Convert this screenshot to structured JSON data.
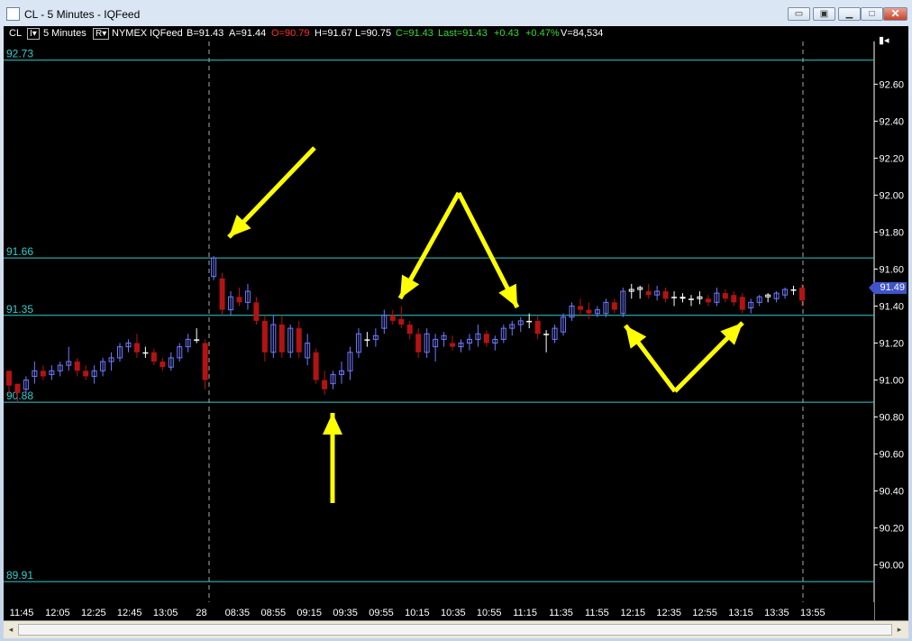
{
  "window": {
    "title": "CL - 5 Minutes - IQFeed",
    "buttons": [
      "restore-down",
      "restore",
      "minimize",
      "maximize",
      "close"
    ]
  },
  "infobar": {
    "symbol": "CL",
    "interval_box": "I▾",
    "interval": "5 Minutes",
    "range_box": "R▾",
    "exchange": "NYMEX",
    "feed": "IQFeed",
    "bid": "B=91.43",
    "ask": "A=91.44",
    "open": "O=90.79",
    "high": "H=91.67",
    "low": "L=90.75",
    "close": "C=91.43",
    "last": "Last=91.43",
    "change": "+0.43",
    "change_pct": "+0.47%",
    "volume": "V=84,534"
  },
  "colors": {
    "up_candle": "#6f79ff",
    "down_candle": "#b31313",
    "doji": "#ffffff",
    "level_line": "#33cccc",
    "axis_text": "#ffffff",
    "arrow": "#ffff00",
    "open_red": "#ff3030",
    "green": "#33dd33"
  },
  "chart": {
    "axis_button": "▮◂",
    "current_price": "91.49",
    "y_ticks": [
      "92.60",
      "92.40",
      "92.20",
      "92.00",
      "91.80",
      "91.60",
      "91.40",
      "91.20",
      "91.00",
      "90.80",
      "90.60",
      "90.40",
      "90.20",
      "90.00"
    ],
    "levels": [
      {
        "label": "92.73",
        "price": 92.73
      },
      {
        "label": "91.66",
        "price": 91.66
      },
      {
        "label": "91.35",
        "price": 91.35
      },
      {
        "label": "90.88",
        "price": 90.88
      },
      {
        "label": "89.91",
        "price": 89.91
      }
    ],
    "x_ticks": [
      "11:45",
      "12:05",
      "12:25",
      "12:45",
      "13:05",
      "28",
      "08:35",
      "08:55",
      "09:15",
      "09:35",
      "09:55",
      "10:15",
      "10:35",
      "10:55",
      "11:15",
      "11:35",
      "11:55",
      "12:15",
      "12:35",
      "12:55",
      "13:15",
      "13:35",
      "13:55"
    ],
    "annotations": "yellow arrows"
  },
  "chart_data": {
    "type": "candlestick",
    "title": "CL - 5 Minutes - IQFeed",
    "xlabel": "",
    "ylabel": "",
    "ylim": [
      89.9,
      92.75
    ],
    "candles": [
      [
        91.05,
        91.0,
        90.92,
        90.97
      ],
      [
        90.98,
        90.98,
        90.88,
        90.93
      ],
      [
        90.95,
        91.02,
        90.92,
        91.0
      ],
      [
        91.02,
        91.1,
        90.98,
        91.05
      ],
      [
        91.05,
        91.08,
        91.0,
        91.02
      ],
      [
        91.03,
        91.08,
        91.0,
        91.05
      ],
      [
        91.05,
        91.1,
        91.02,
        91.08
      ],
      [
        91.08,
        91.18,
        91.05,
        91.1
      ],
      [
        91.1,
        91.12,
        91.02,
        91.05
      ],
      [
        91.05,
        91.08,
        91.0,
        91.02
      ],
      [
        91.02,
        91.08,
        90.98,
        91.05
      ],
      [
        91.05,
        91.12,
        91.02,
        91.1
      ],
      [
        91.1,
        91.15,
        91.05,
        91.12
      ],
      [
        91.12,
        91.2,
        91.1,
        91.18
      ],
      [
        91.18,
        91.22,
        91.15,
        91.2
      ],
      [
        91.2,
        91.25,
        91.12,
        91.15
      ],
      [
        91.15,
        91.18,
        91.12,
        91.15
      ],
      [
        91.15,
        91.17,
        91.08,
        91.1
      ],
      [
        91.1,
        91.12,
        91.05,
        91.07
      ],
      [
        91.07,
        91.15,
        91.05,
        91.12
      ],
      [
        91.12,
        91.2,
        91.1,
        91.18
      ],
      [
        91.18,
        91.25,
        91.15,
        91.22
      ],
      [
        91.22,
        91.28,
        91.2,
        91.22
      ],
      [
        91.2,
        91.22,
        90.95,
        91.0
      ],
      [
        91.56,
        91.67,
        91.54,
        91.66
      ],
      [
        91.55,
        91.58,
        91.35,
        91.38
      ],
      [
        91.38,
        91.48,
        91.35,
        91.45
      ],
      [
        91.45,
        91.5,
        91.4,
        91.42
      ],
      [
        91.42,
        91.52,
        91.38,
        91.48
      ],
      [
        91.42,
        91.45,
        91.3,
        91.32
      ],
      [
        91.32,
        91.35,
        91.1,
        91.15
      ],
      [
        91.15,
        91.35,
        91.12,
        91.3
      ],
      [
        91.3,
        91.35,
        91.12,
        91.15
      ],
      [
        91.15,
        91.3,
        91.12,
        91.28
      ],
      [
        91.28,
        91.32,
        91.12,
        91.15
      ],
      [
        91.12,
        91.25,
        91.08,
        91.2
      ],
      [
        91.15,
        91.17,
        90.98,
        91.0
      ],
      [
        91.0,
        91.05,
        90.92,
        90.95
      ],
      [
        90.98,
        91.05,
        90.95,
        91.03
      ],
      [
        91.03,
        91.1,
        90.98,
        91.05
      ],
      [
        91.05,
        91.18,
        91.0,
        91.15
      ],
      [
        91.15,
        91.28,
        91.12,
        91.25
      ],
      [
        91.22,
        91.26,
        91.18,
        91.22
      ],
      [
        91.22,
        91.28,
        91.18,
        91.24
      ],
      [
        91.28,
        91.38,
        91.25,
        91.35
      ],
      [
        91.35,
        91.38,
        91.3,
        91.32
      ],
      [
        91.33,
        91.4,
        91.28,
        91.3
      ],
      [
        91.3,
        91.32,
        91.22,
        91.25
      ],
      [
        91.25,
        91.28,
        91.12,
        91.15
      ],
      [
        91.15,
        91.28,
        91.12,
        91.25
      ],
      [
        91.18,
        91.25,
        91.1,
        91.22
      ],
      [
        91.22,
        91.26,
        91.18,
        91.24
      ],
      [
        91.2,
        91.24,
        91.16,
        91.18
      ],
      [
        91.18,
        91.22,
        91.15,
        91.2
      ],
      [
        91.2,
        91.25,
        91.16,
        91.22
      ],
      [
        91.22,
        91.3,
        91.18,
        91.25
      ],
      [
        91.25,
        91.27,
        91.18,
        91.2
      ],
      [
        91.2,
        91.24,
        91.16,
        91.22
      ],
      [
        91.22,
        91.3,
        91.2,
        91.28
      ],
      [
        91.28,
        91.32,
        91.24,
        91.3
      ],
      [
        91.3,
        91.34,
        91.26,
        91.32
      ],
      [
        91.32,
        91.36,
        91.28,
        91.32
      ],
      [
        91.32,
        91.35,
        91.22,
        91.25
      ],
      [
        91.25,
        91.27,
        91.15,
        91.25
      ],
      [
        91.22,
        91.3,
        91.2,
        91.28
      ],
      [
        91.26,
        91.36,
        91.24,
        91.34
      ],
      [
        91.34,
        91.42,
        91.32,
        91.4
      ],
      [
        91.4,
        91.44,
        91.35,
        91.38
      ],
      [
        91.38,
        91.42,
        91.33,
        91.36
      ],
      [
        91.36,
        91.4,
        91.34,
        91.38
      ],
      [
        91.36,
        91.44,
        91.34,
        91.42
      ],
      [
        91.42,
        91.44,
        91.36,
        91.38
      ],
      [
        91.36,
        91.5,
        91.34,
        91.48
      ],
      [
        91.48,
        91.52,
        91.44,
        91.49
      ],
      [
        91.49,
        91.51,
        91.44,
        91.5
      ],
      [
        91.48,
        91.52,
        91.44,
        91.46
      ],
      [
        91.46,
        91.51,
        91.43,
        91.48
      ],
      [
        91.48,
        91.5,
        91.42,
        91.44
      ],
      [
        91.45,
        91.48,
        91.4,
        91.45
      ],
      [
        91.45,
        91.47,
        91.42,
        91.44
      ],
      [
        91.44,
        91.46,
        91.4,
        91.44
      ],
      [
        91.44,
        91.48,
        91.41,
        91.45
      ],
      [
        91.44,
        91.46,
        91.4,
        91.42
      ],
      [
        91.42,
        91.5,
        91.4,
        91.47
      ],
      [
        91.47,
        91.49,
        91.42,
        91.44
      ],
      [
        91.46,
        91.48,
        91.4,
        91.42
      ],
      [
        91.45,
        91.47,
        91.36,
        91.38
      ],
      [
        91.39,
        91.44,
        91.36,
        91.42
      ],
      [
        91.42,
        91.46,
        91.4,
        91.45
      ],
      [
        91.45,
        91.47,
        91.42,
        91.46
      ],
      [
        91.44,
        91.48,
        91.42,
        91.47
      ],
      [
        91.46,
        91.5,
        91.44,
        91.49
      ],
      [
        91.49,
        91.51,
        91.46,
        91.49
      ],
      [
        91.5,
        91.52,
        91.4,
        91.43
      ]
    ]
  }
}
